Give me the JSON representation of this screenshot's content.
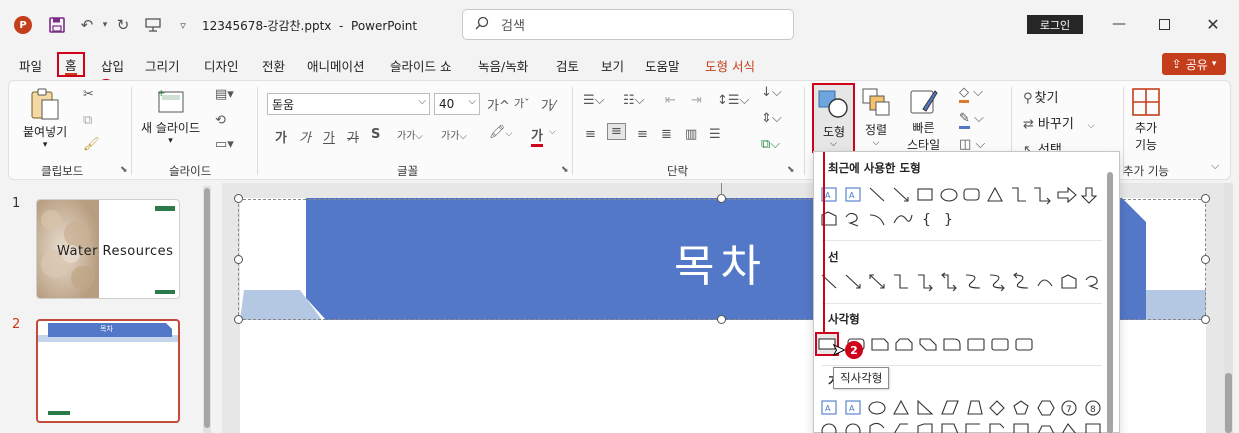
{
  "titlebar": {
    "filename": "12345678-강감찬.pptx",
    "separator": "-",
    "app_name": "PowerPoint",
    "search_placeholder": "검색",
    "login_label": "로그인"
  },
  "tabs": [
    "파일",
    "홈",
    "삽입",
    "그리기",
    "디자인",
    "전환",
    "애니메이션",
    "슬라이드 쇼",
    "녹음/녹화",
    "검토",
    "보기",
    "도움말",
    "도형 서식"
  ],
  "active_tab": "홈",
  "share_label": "공유",
  "badges": {
    "one": "1",
    "two": "2"
  },
  "ribbon": {
    "clipboard": {
      "paste_label": "붙여넣기",
      "group_label": "클립보드"
    },
    "slides": {
      "new_slide_label": "새 슬라이드",
      "group_label": "슬라이드"
    },
    "font": {
      "font_name": "돋움",
      "font_size": "40",
      "group_label": "글꼴",
      "bold": "가",
      "italic": "가",
      "underline": "가",
      "strike": "가",
      "shadow": "S",
      "spacing": "가가",
      "case": "가가",
      "highlight": "가",
      "fontcolor": "가",
      "grow": "가",
      "shrink": "가",
      "clear": "가"
    },
    "paragraph": {
      "group_label": "단락"
    },
    "drawing": {
      "shape_label": "도형",
      "arrange_label": "정렬",
      "quick_style_line1": "빠른",
      "quick_style_line2": "스타일"
    },
    "editing": {
      "find_label": "찾기",
      "replace_label": "바꾸기",
      "select_label": "선택"
    },
    "addins": {
      "addin_line1": "추가",
      "addin_line2": "기능",
      "group_label": "추가 기능"
    }
  },
  "slides": [
    {
      "number": "1",
      "title": "Water Resources"
    },
    {
      "number": "2",
      "title": "목차"
    }
  ],
  "slide_title": "목차",
  "gallery": {
    "recent_heading": "최근에 사용한 도형",
    "lines_heading": "선",
    "rect_heading": "사각형",
    "basic_heading_partial": "기"
  },
  "tooltip": "직사각형",
  "colors": {
    "accent": "#c43e1c",
    "highlight_red": "#d0021b",
    "title_fill": "#5478c8",
    "light_blue": "#b4c8e4"
  }
}
